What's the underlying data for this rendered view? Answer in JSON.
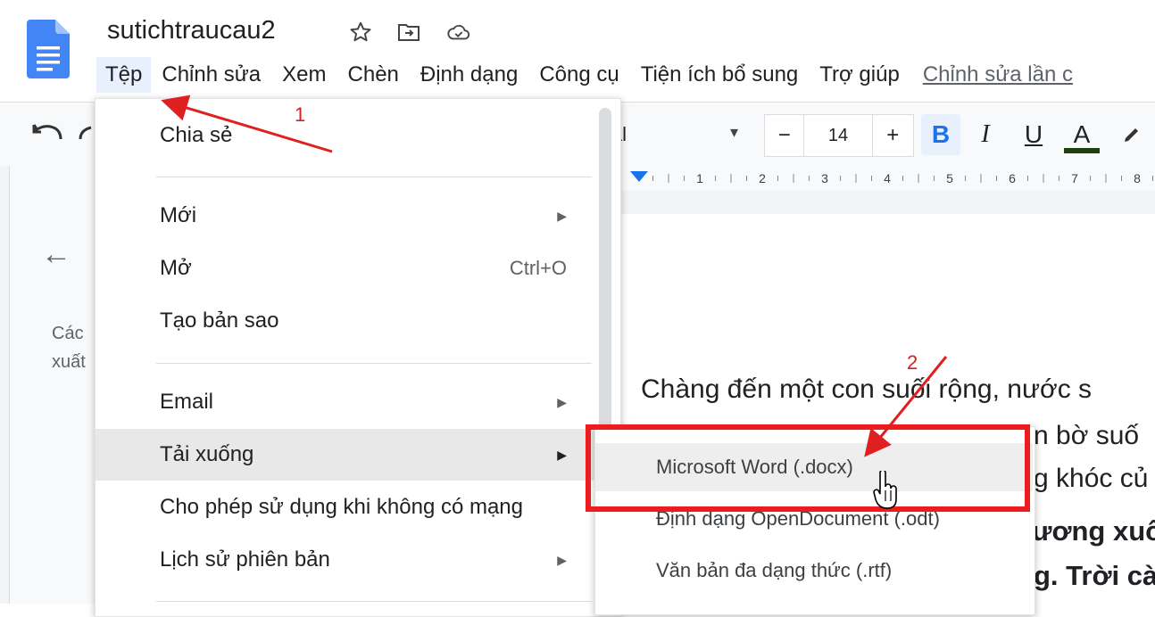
{
  "app": {
    "doc_title": "sutichtraucau2",
    "icons": [
      "docs-logo-icon",
      "star-icon",
      "move-folder-icon",
      "cloud-saved-icon"
    ]
  },
  "menubar": {
    "items": [
      "Tệp",
      "Chỉnh sửa",
      "Xem",
      "Chèn",
      "Định dạng",
      "Công cụ",
      "Tiện ích bổ sung",
      "Trợ giúp"
    ],
    "active": "Tệp",
    "last_edit": "Chỉnh sửa lần c"
  },
  "toolbar": {
    "font_name": "ial",
    "font_size": "14",
    "minus": "−",
    "plus": "+",
    "bold": "B",
    "italic": "I",
    "underline": "U",
    "text_color": "A",
    "text_color_hex": "#1f3f10"
  },
  "ruler": {
    "ticks": [
      "1",
      "2",
      "3",
      "4",
      "5",
      "6",
      "7",
      "8"
    ]
  },
  "outline": {
    "back_icon": "arrow-left-icon",
    "lines": [
      "Các",
      "xuất"
    ]
  },
  "document": {
    "line1": "Chàng đến một con suối rộng, nước s",
    "line2": "n bờ suố",
    "line3": "g khóc củ",
    "line4": "ương xuố",
    "line5": "g. Trời cà"
  },
  "file_menu": {
    "share": "Chia sẻ",
    "new": "Mới",
    "open": "Mở",
    "open_shortcut": "Ctrl+O",
    "make_copy": "Tạo bản sao",
    "email": "Email",
    "download": "Tải xuống",
    "offline": "Cho phép sử dụng khi không có mạng",
    "version_history": "Lịch sử phiên bản"
  },
  "download_submenu": {
    "docx": "Microsoft Word (.docx)",
    "odt": "Định dạng OpenDocument (.odt)",
    "rtf": "Văn bản đa dạng thức (.rtf)"
  },
  "annotations": {
    "step1": "1",
    "step2": "2",
    "color": "#e02020"
  }
}
